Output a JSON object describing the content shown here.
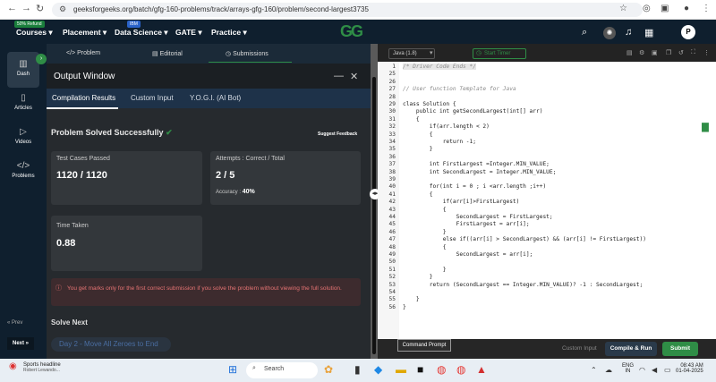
{
  "browser": {
    "url": "geeksforgeeks.org/batch/gfg-160-problems/track/arrays-gfg-160/problem/second-largest3735"
  },
  "gfg_nav": {
    "badge_refund": "50% Refund",
    "badge_ibm": "IBM",
    "items": [
      "Courses ▾",
      "Placement ▾",
      "Data Science ▾",
      "GATE ▾",
      "Practice ▾"
    ],
    "logo": "GG",
    "avatar": "P"
  },
  "rail": {
    "items": [
      "Dash",
      "Articles",
      "Videos",
      "Problems"
    ],
    "prev": "« Prev",
    "next": "Next »"
  },
  "problem_tabs": [
    "</> Problem",
    "Editorial",
    "Submissions"
  ],
  "output": {
    "title": "Output Window",
    "tabs": [
      "Compilation Results",
      "Custom Input",
      "Y.O.G.I. (AI Bot)"
    ],
    "solved": "Problem Solved Successfully",
    "suggest": "Suggest Feedback",
    "test_cases_label": "Test Cases Passed",
    "test_cases_value": "1120 / 1120",
    "attempts_label": "Attempts : Correct / Total",
    "attempts_value": "2 / 5",
    "accuracy_label": "Accuracy :",
    "accuracy_value": "40%",
    "time_label": "Time Taken",
    "time_value": "0.88",
    "warning": "You get marks only for the first correct submission if you solve the problem without viewing the full solution.",
    "solve_next": "Solve Next",
    "day_button": "Day 2 - Move All Zeroes to End"
  },
  "editor": {
    "language": "Java (1.8)",
    "timer": "Start Timer",
    "lines": [
      {
        "n": "1",
        "t": "/* Driver Code Ends */",
        "cls": "cm",
        "hl": true
      },
      {
        "n": "25",
        "t": ""
      },
      {
        "n": "26",
        "t": ""
      },
      {
        "n": "27",
        "t": "// User function Template for Java",
        "cls": "cm"
      },
      {
        "n": "28",
        "t": ""
      },
      {
        "n": "29",
        "t": "class Solution {"
      },
      {
        "n": "30",
        "t": "    public int getSecondLargest(int[] arr)"
      },
      {
        "n": "31",
        "t": "    {"
      },
      {
        "n": "32",
        "t": "        if(arr.length < 2)"
      },
      {
        "n": "33",
        "t": "        {"
      },
      {
        "n": "34",
        "t": "            return -1;"
      },
      {
        "n": "35",
        "t": "        }"
      },
      {
        "n": "36",
        "t": ""
      },
      {
        "n": "37",
        "t": "        int FirstLargest =Integer.MIN_VALUE;"
      },
      {
        "n": "38",
        "t": "        int SecondLargest = Integer.MIN_VALUE;"
      },
      {
        "n": "39",
        "t": ""
      },
      {
        "n": "40",
        "t": "        for(int i = 0 ; i <arr.length ;i++)"
      },
      {
        "n": "41",
        "t": "        {"
      },
      {
        "n": "42",
        "t": "            if(arr[i]>FirstLargest)"
      },
      {
        "n": "43",
        "t": "            {"
      },
      {
        "n": "44",
        "t": "                SecondLargest = FirstLargest;"
      },
      {
        "n": "45",
        "t": "                FirstLargest = arr[i];"
      },
      {
        "n": "46",
        "t": "            }"
      },
      {
        "n": "47",
        "t": "            else if((arr[i] > SecondLargest) && (arr[i] != FirstLargest))"
      },
      {
        "n": "48",
        "t": "            {"
      },
      {
        "n": "49",
        "t": "                SecondLargest = arr[i];"
      },
      {
        "n": "50",
        "t": ""
      },
      {
        "n": "51",
        "t": "            }"
      },
      {
        "n": "52",
        "t": "        }"
      },
      {
        "n": "53",
        "t": "        return (SecondLargest == Integer.MIN_VALUE)? -1 : SecondLargest;"
      },
      {
        "n": "54",
        "t": ""
      },
      {
        "n": "55",
        "t": "    }"
      },
      {
        "n": "56",
        "t": "}"
      }
    ],
    "cmd_tip": "Command Prompt",
    "custom_input": "Custom Input",
    "compile": "Compile & Run",
    "submit": "Submit"
  },
  "taskbar": {
    "news_title": "Sports headline",
    "news_sub": "Robert Lewando...",
    "search": "Search",
    "lang": "ENG",
    "lang2": "IN",
    "time": "08:43 AM",
    "date": "01-04-2025"
  }
}
